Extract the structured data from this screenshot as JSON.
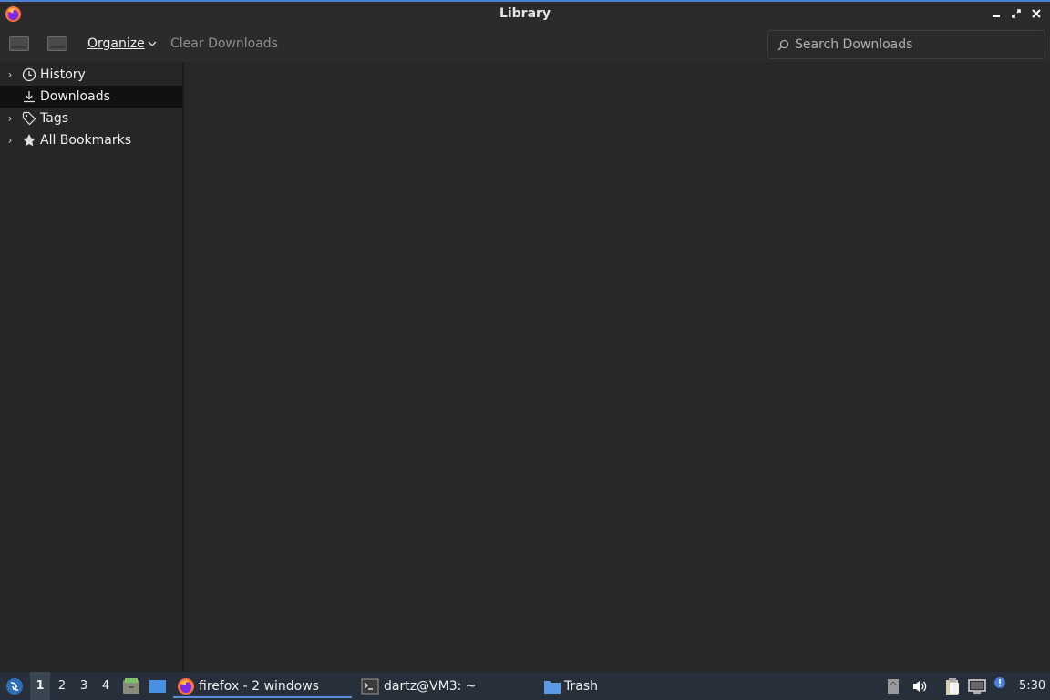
{
  "window": {
    "title": "Library"
  },
  "toolbar": {
    "organize_label": "Organize",
    "clear_downloads_label": "Clear Downloads",
    "search_placeholder": "Search Downloads"
  },
  "sidebar": {
    "items": [
      {
        "label": "History",
        "icon": "clock-icon",
        "expandable": true,
        "selected": false
      },
      {
        "label": "Downloads",
        "icon": "download-icon",
        "expandable": false,
        "selected": true
      },
      {
        "label": "Tags",
        "icon": "tag-icon",
        "expandable": true,
        "selected": false
      },
      {
        "label": "All Bookmarks",
        "icon": "star-icon",
        "expandable": true,
        "selected": false
      }
    ]
  },
  "taskbar": {
    "workspaces": [
      "1",
      "2",
      "3",
      "4"
    ],
    "active_workspace": "1",
    "tasks": [
      {
        "label": "firefox - 2 windows",
        "icon": "firefox-icon",
        "active": true
      },
      {
        "label": "dartz@VM3: ~",
        "icon": "terminal-icon",
        "active": false
      },
      {
        "label": "Trash",
        "icon": "folder-icon",
        "active": false
      }
    ],
    "clock": "5:30"
  },
  "colors": {
    "accent": "#4a7fd6",
    "selected_row": "#111111",
    "taskbar_bg": "#262f3a"
  }
}
